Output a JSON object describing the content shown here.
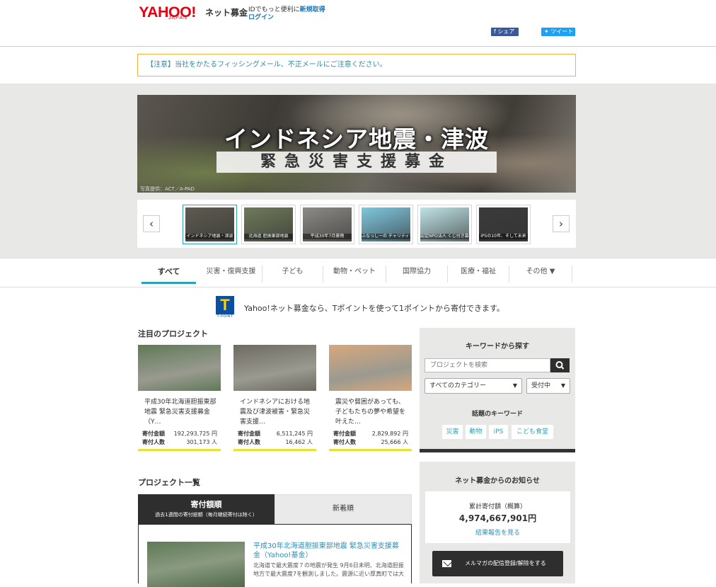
{
  "header": {
    "logo": "YAHOO!",
    "logo_sub": "JAPAN",
    "service": "ネット募金",
    "id_text": "IDでもっと便利に",
    "register": "新規取得",
    "login": "ログイン",
    "share_fb": "f シェア",
    "share_tw": "ツイート"
  },
  "notice": "【注意】当社をかたるフィッシングメール、不正メールにご注意ください。",
  "hero": {
    "title": "インドネシア地震・津波",
    "subtitle": "緊急災害支援募金",
    "credit": "写真提供：ACT／A-PAD"
  },
  "carousel": {
    "prev": "‹",
    "next": "›",
    "items": [
      {
        "label": "インドネシア地震・津波",
        "color": "#5e5b50"
      },
      {
        "label": "北海道 胆振東部地震",
        "color": "#6f7a5a"
      },
      {
        "label": "平成30年7月豪雨",
        "color": "#8d8b86"
      },
      {
        "label": "ふなっしーの チャリティー祭り2018",
        "color": "#7ec8e0"
      },
      {
        "label": "認定NPO法人 くじ付き募金",
        "color": "#bfe3e6"
      },
      {
        "label": "iPSの10年、そして未来",
        "color": "#3b3b3b"
      }
    ]
  },
  "nav": {
    "items": [
      "すべて",
      "災害・復興支援",
      "子ども",
      "動物・ペット",
      "国際協力",
      "医療・福祉",
      "その他 ▼"
    ]
  },
  "tpoint": {
    "logo": "T",
    "caption": "T-POINT",
    "text": "Yahoo!ネット募金なら、Tポイントを使って1ポイントから寄付できます。"
  },
  "featured": {
    "heading": "注目のプロジェクト",
    "amount_label": "寄付金額",
    "people_label": "寄付人数",
    "cards": [
      {
        "title": "平成30年北海道胆振東部地震 緊急災害支援募金（Y…",
        "amount": "192,293,725 円",
        "people": "301,173 人",
        "color": "#5f7a57"
      },
      {
        "title": "インドネシアにおける地震及び津波被害・緊急災害支援…",
        "amount": "6,511,245 円",
        "people": "16,462 人",
        "color": "#6d6a62"
      },
      {
        "title": "震災や貧困があっても、子どもたちの夢や希望を叶えた…",
        "amount": "2,829,892 円",
        "people": "25,666 人",
        "color": "#d8a77c"
      }
    ]
  },
  "search": {
    "heading": "キーワードから探す",
    "placeholder": "プロジェクトを検索",
    "category": "すべてのカテゴリー",
    "status": "受付中",
    "topic_heading": "話題のキーワード",
    "keywords": [
      "災害",
      "動物",
      "iPS",
      "こども食堂"
    ]
  },
  "news": {
    "heading": "ネット募金からのお知らせ",
    "total_label": "累計寄付額（概算）",
    "total": "4,974,667,901円",
    "report_link": "結果報告を見る",
    "mail": "メルマガの配信登録/解除をする"
  },
  "projects": {
    "heading": "プロジェクト一覧",
    "tab_active": "寄付額順",
    "tab_active_sub": "過去1週間の寄付総額（毎月継続寄付は除く）",
    "tab_new": "新着順",
    "item": {
      "title": "平成30年北海道胆振東部地震 緊急災害支援募金（Yahoo!基金）",
      "desc": "北海道で最大震度７の地震が発生 9月6日未明、北海道胆振地方で最大震度7を観測しました。震源に近い厚真町では大"
    }
  }
}
